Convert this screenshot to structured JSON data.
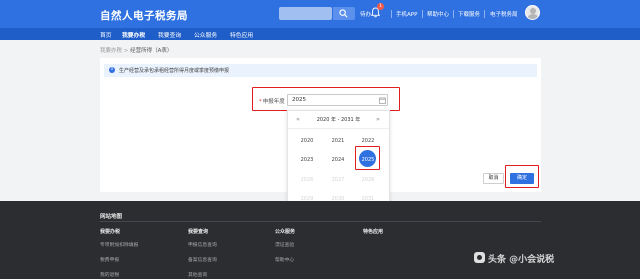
{
  "header": {
    "logo": "自然人电子税务局",
    "todo": "待办",
    "notification_count": "1",
    "mobile_app": "手机APP",
    "help_center": "帮助中心",
    "download_center": "下载服务",
    "e_tax": "电子税务局"
  },
  "nav": {
    "items": [
      "首页",
      "我要办税",
      "我要查询",
      "公众服务",
      "特色应用"
    ],
    "active": "我要办税"
  },
  "breadcrumb": {
    "parent": "我要办税",
    "separator": ">",
    "current": "经营所得（A表）"
  },
  "notice": {
    "icon": "info-icon",
    "text": "生产经营及承包承租经营所得月度或季度预缴申报"
  },
  "form": {
    "year_label": "申报年度",
    "required_mark": "*",
    "year_value": "2025"
  },
  "picker": {
    "range": "2020 年 - 2031 年",
    "prev": "«",
    "next": "»",
    "years": [
      "2020",
      "2021",
      "2022",
      "2023",
      "2024",
      "2025",
      "2026",
      "2027",
      "2028",
      "2029",
      "2030",
      "2031"
    ],
    "selected": "2025"
  },
  "actions": {
    "cancel": "取消",
    "confirm": "确定"
  },
  "footer": {
    "title": "网站地图",
    "columns": [
      {
        "heading": "我要办税",
        "links": [
          "专项附加扣除填报",
          "税费申报",
          "我的退税"
        ]
      },
      {
        "heading": "我要查询",
        "links": [
          "申报信息查询",
          "备案信息查询",
          "其他查询"
        ]
      },
      {
        "heading": "公众服务",
        "links": [
          "漂证查验",
          "帮助中心"
        ]
      },
      {
        "heading": "特色应用",
        "links": []
      }
    ]
  },
  "watermark": "头条 @小会说税",
  "colors": {
    "primary": "#2f71e0",
    "nav": "#1f5ec9",
    "highlight": "#e21d1d",
    "footer": "#2b2d31"
  }
}
